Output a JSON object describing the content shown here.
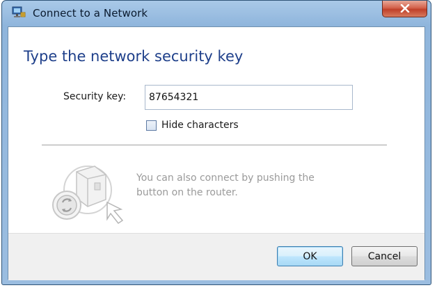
{
  "window": {
    "title": "Connect to a Network",
    "icons": {
      "app": "network-icon",
      "close": "close-icon"
    }
  },
  "content": {
    "heading": "Type the network security key",
    "security_key_label": "Security key:",
    "security_key_value": "87654321",
    "hide_characters_label": "Hide characters",
    "hide_characters_checked": false,
    "wps_hint": "You can also connect by pushing the button on the router.",
    "wps_icon": "router-push-button-icon"
  },
  "buttons": {
    "ok_label": "OK",
    "cancel_label": "Cancel"
  },
  "colors": {
    "heading": "#1e3f8a",
    "hint_text": "#9a9a9a",
    "title_bar": "#9bbde0",
    "close_button": "#c0402a"
  }
}
